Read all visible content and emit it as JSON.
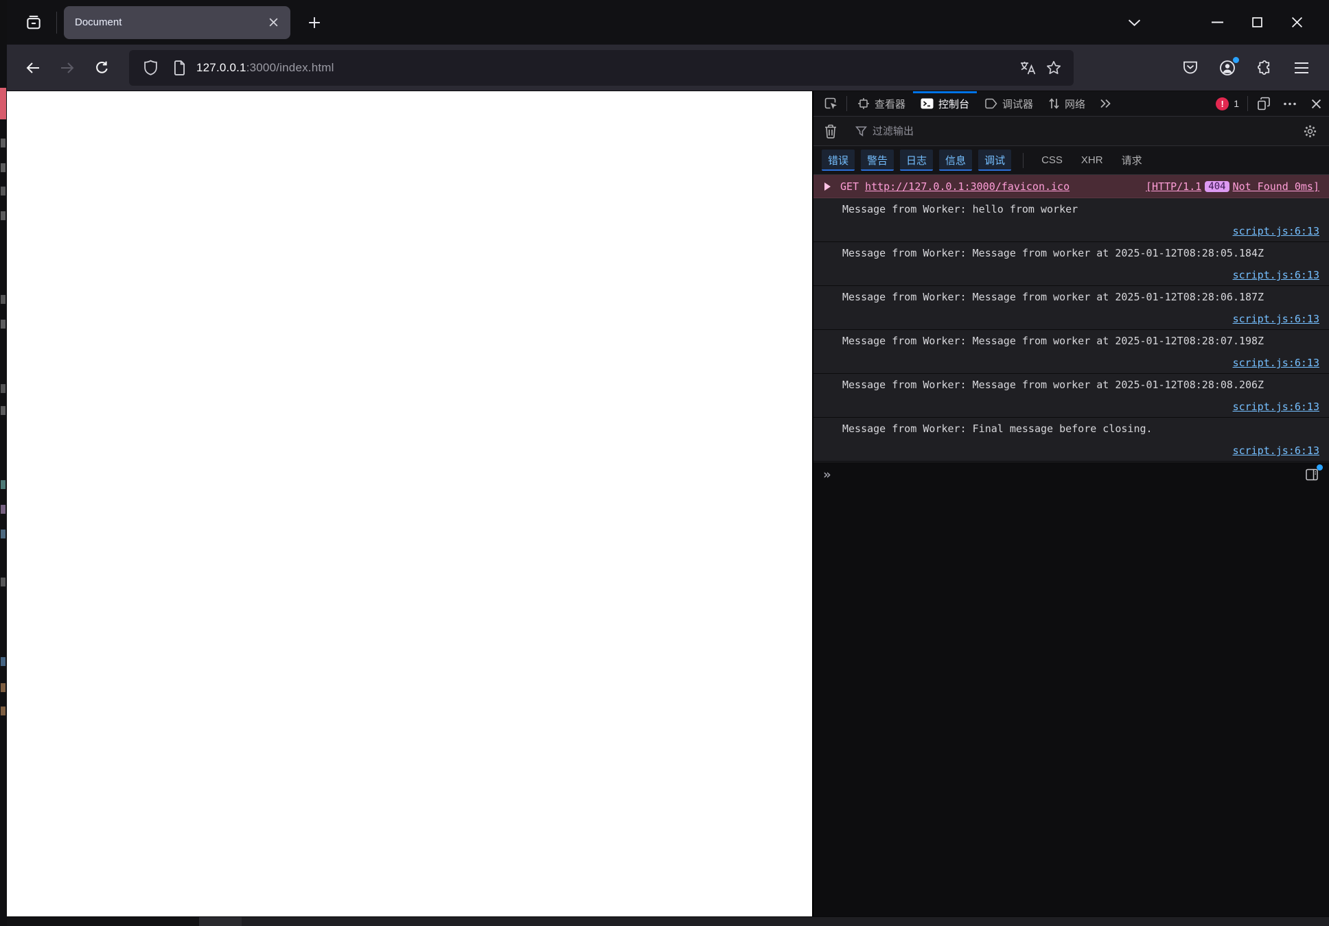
{
  "browser": {
    "tab": {
      "title": "Document"
    },
    "url": {
      "host": "127.0.0.1",
      "path": ":3000/index.html"
    }
  },
  "devtools": {
    "toolbar": {
      "tabs": [
        {
          "label": "查看器"
        },
        {
          "label": "控制台"
        },
        {
          "label": "调试器"
        },
        {
          "label": "网络"
        }
      ],
      "error_count": "1"
    },
    "filter": {
      "placeholder": "过滤输出"
    },
    "level_filters": [
      "错误",
      "警告",
      "日志",
      "信息",
      "调试"
    ],
    "type_filters": [
      "CSS",
      "XHR",
      "请求"
    ],
    "network_request": {
      "method": "GET",
      "url": "http://127.0.0.1:3000/favicon.ico",
      "protocol": "[HTTP/1.1",
      "status": "404",
      "status_text": "Not Found 0ms]"
    },
    "messages": [
      {
        "text": "Message from Worker: hello from worker",
        "source": "script.js:6:13"
      },
      {
        "text": "Message from Worker: Message from worker at 2025-01-12T08:28:05.184Z",
        "source": "script.js:6:13"
      },
      {
        "text": "Message from Worker: Message from worker at 2025-01-12T08:28:06.187Z",
        "source": "script.js:6:13"
      },
      {
        "text": "Message from Worker: Message from worker at 2025-01-12T08:28:07.198Z",
        "source": "script.js:6:13"
      },
      {
        "text": "Message from Worker: Message from worker at 2025-01-12T08:28:08.206Z",
        "source": "script.js:6:13"
      },
      {
        "text": "Message from Worker: Final message before closing.",
        "source": "script.js:6:13"
      }
    ],
    "input_prompt": "»"
  }
}
